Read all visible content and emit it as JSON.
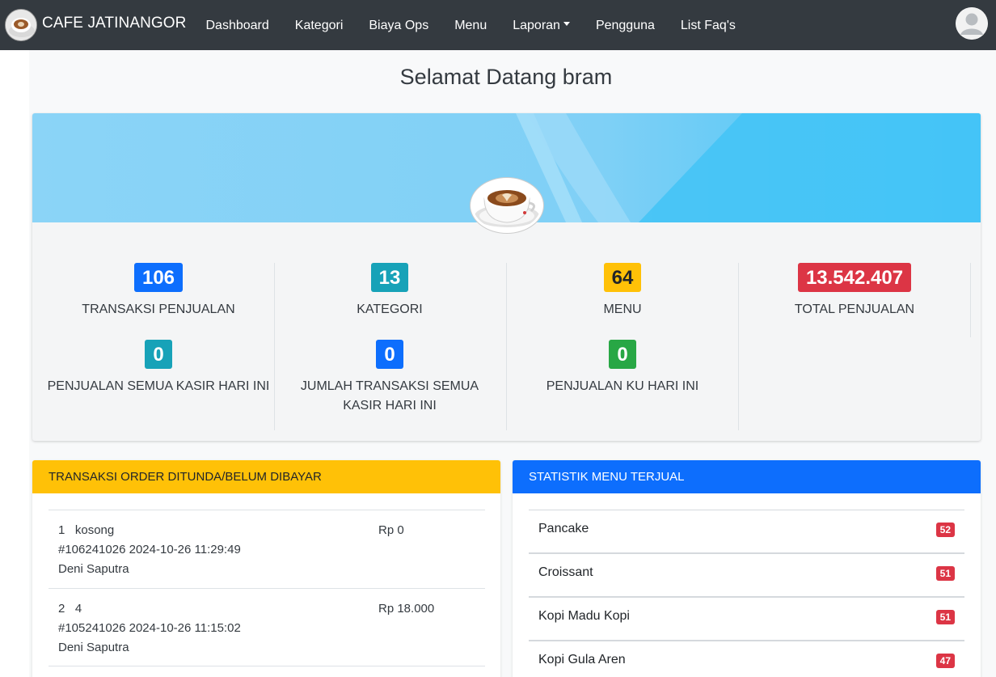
{
  "navbar": {
    "brand": "CAFE JATINANGOR",
    "items": [
      {
        "label": "Dashboard"
      },
      {
        "label": "Kategori"
      },
      {
        "label": "Biaya Ops"
      },
      {
        "label": "Menu"
      },
      {
        "label": "Laporan",
        "dropdown": true
      },
      {
        "label": "Pengguna"
      },
      {
        "label": "List Faq's"
      }
    ]
  },
  "welcome": "Selamat Datang bram",
  "stats": {
    "transaksi": {
      "value": "106",
      "label": "TRANSAKSI PENJUALAN",
      "color": "#0d6efd"
    },
    "kategori": {
      "value": "13",
      "label": "KATEGORI",
      "color": "#17a2b8"
    },
    "menu": {
      "value": "64",
      "label": "MENU",
      "color": "#ffc107"
    },
    "total": {
      "value": "13.542.407",
      "label": "TOTAL PENJUALAN",
      "color": "#dc3545"
    },
    "penjualan_kasir": {
      "value": "0",
      "label": "PENJUALAN SEMUA KASIR HARI INI",
      "color": "#17a2b8"
    },
    "jumlah_transaksi": {
      "value": "0",
      "label": "JUMLAH TRANSAKSI SEMUA KASIR HARI INI",
      "color": "#0d6efd"
    },
    "penjualan_ku": {
      "value": "0",
      "label": "PENJUALAN KU HARI INI",
      "color": "#28a745"
    }
  },
  "orders": {
    "title": "TRANSAKSI ORDER DITUNDA/BELUM DIBAYAR",
    "items": [
      {
        "no": "1",
        "table": "kosong",
        "code": "#106241026",
        "datetime": "2024-10-26 11:29:49",
        "cashier": "Deni Saputra",
        "amount": "Rp 0"
      },
      {
        "no": "2",
        "table": "4",
        "code": "#105241026",
        "datetime": "2024-10-26 11:15:02",
        "cashier": "Deni Saputra",
        "amount": "Rp 18.000"
      }
    ]
  },
  "menu_stats": {
    "title": "STATISTIK MENU TERJUAL",
    "items": [
      {
        "name": "Pancake",
        "count": "52"
      },
      {
        "name": "Croissant",
        "count": "51"
      },
      {
        "name": "Kopi Madu Kopi",
        "count": "51"
      },
      {
        "name": "Kopi Gula Aren",
        "count": "47"
      }
    ]
  },
  "colors": {
    "navbar": "#343a40",
    "warning": "#ffc107",
    "primary": "#0d6efd",
    "danger": "#dc3545"
  }
}
